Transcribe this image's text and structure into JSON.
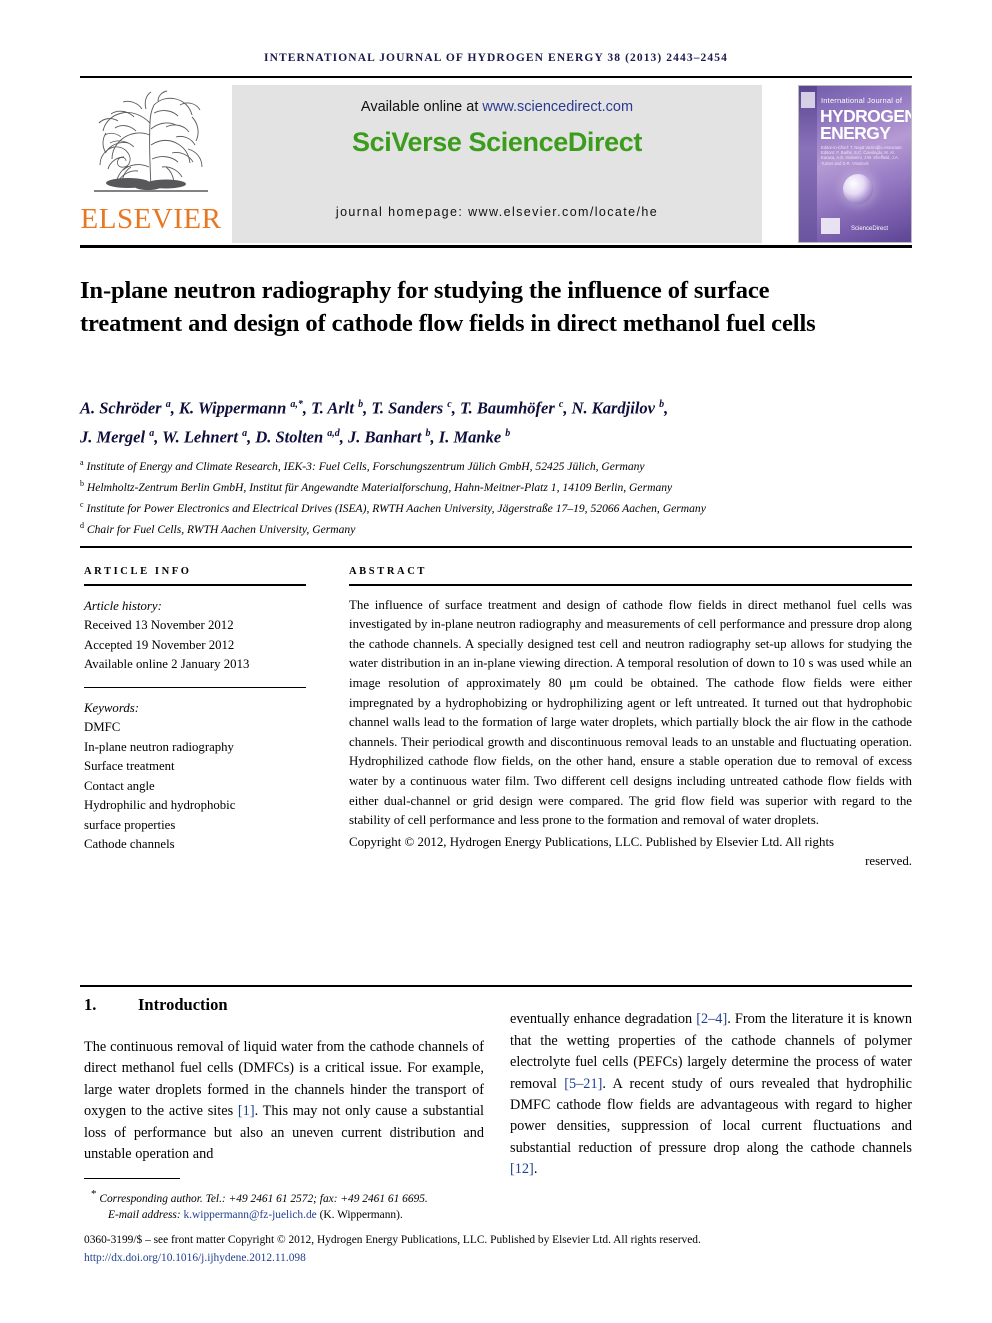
{
  "running_head": "International Journal of Hydrogen Energy 38 (2013) 2443–2454",
  "banner": {
    "publisher_name": "ELSEVIER",
    "available_prefix": "Available online at ",
    "available_url": "www.sciencedirect.com",
    "platform": "SciVerse ScienceDirect",
    "homepage": "journal homepage: www.elsevier.com/locate/he",
    "cover": {
      "line1": "International Journal of",
      "line2": "HYDROGEN",
      "line3": "ENERGY",
      "editors": "Editor-in-Chief: T. Nejat Veziroğlu   Associate Editors: F. Barbir, S.C. Cavuloglu, M. Al. Karaca, A.E. Hosseini, J.W. Sheffield, J.A. Turner and D.R. Vrsalović",
      "sciencedirect": "ScienceDirect"
    }
  },
  "title": "In-plane neutron radiography for studying the influence of surface treatment and design of cathode flow fields in direct methanol fuel cells",
  "authors_line1": "A. Schröder <sup>a</sup>, K. Wippermann <sup>a,*</sup>, T. Arlt <sup>b</sup>, T. Sanders <sup>c</sup>, T. Baumhöfer <sup>c</sup>, N. Kardjilov <sup>b</sup>,",
  "authors_line2": "J. Mergel <sup>a</sup>, W. Lehnert <sup>a</sup>, D. Stolten <sup>a,d</sup>, J. Banhart <sup>b</sup>, I. Manke <sup>b</sup>",
  "affiliations": [
    "<sup>a</sup> Institute of Energy and Climate Research, IEK-3: Fuel Cells, Forschungszentrum Jülich GmbH, 52425 Jülich, Germany",
    "<sup>b</sup> Helmholtz-Zentrum Berlin GmbH, Institut für Angewandte Materialforschung, Hahn-Meitner-Platz 1, 14109 Berlin, Germany",
    "<sup>c</sup> Institute for Power Electronics and Electrical Drives (ISEA), RWTH Aachen University, Jägerstraße 17–19, 52066 Aachen, Germany",
    "<sup>d</sup> Chair for Fuel Cells, RWTH Aachen University, Germany"
  ],
  "article_info": {
    "heading": "ARTICLE INFO",
    "history_label": "Article history:",
    "history": [
      "Received 13 November 2012",
      "Accepted 19 November 2012",
      "Available online 2 January 2013"
    ],
    "keywords_label": "Keywords:",
    "keywords": [
      "DMFC",
      "In-plane neutron radiography",
      "Surface treatment",
      "Contact angle",
      "Hydrophilic and hydrophobic",
      "surface properties",
      "Cathode channels"
    ]
  },
  "abstract": {
    "heading": "ABSTRACT",
    "body": "The influence of surface treatment and design of cathode flow fields in direct methanol fuel cells was investigated by in-plane neutron radiography and measurements of cell performance and pressure drop along the cathode channels. A specially designed test cell and neutron radiography set-up allows for studying the water distribution in an in-plane viewing direction. A temporal resolution of down to 10 s was used while an image resolution of approximately 80 μm could be obtained. The cathode flow fields were either impregnated by a hydrophobizing or hydrophilizing agent or left untreated. It turned out that hydrophobic channel walls lead to the formation of large water droplets, which partially block the air flow in the cathode channels. Their periodical growth and discontinuous removal leads to an unstable and fluctuating operation. Hydrophilized cathode flow fields, on the other hand, ensure a stable operation due to removal of excess water by a continuous water film. Two different cell designs including untreated cathode flow fields with either dual-channel or grid design were compared. The grid flow field was superior with regard to the stability of cell performance and less prone to the formation and removal of water droplets.",
    "copyright_main": "Copyright © 2012, Hydrogen Energy Publications, LLC. Published by Elsevier Ltd. All rights",
    "copyright_tail": "reserved."
  },
  "section": {
    "number": "1.",
    "heading": "Introduction"
  },
  "intro_left": "The continuous removal of liquid water from the cathode channels of direct methanol fuel cells (DMFCs) is a critical issue. For example, large water droplets formed in the channels hinder the transport of oxygen to the active sites [1]. This may not only cause a substantial loss of performance but also an uneven current distribution and unstable operation and",
  "intro_right": "eventually enhance degradation [2–4]. From the literature it is known that the wetting properties of the cathode channels of polymer electrolyte fuel cells (PEFCs) largely determine the process of water removal [5–21]. A recent study of ours revealed that hydrophilic DMFC cathode flow fields are advantageous with regard to higher power densities, suppression of local current fluctuations and substantial reduction of pressure drop along the cathode channels [12].",
  "footnotes": {
    "corresponding": "Corresponding author. Tel.: +49 2461 61 2572; fax: +49 2461 61 6695.",
    "email_label": "E-mail address: ",
    "email": "k.wippermann@fz-juelich.de",
    "email_suffix": " (K. Wippermann).",
    "issn_line": "0360-3199/$ – see front matter Copyright © 2012, Hydrogen Energy Publications, LLC. Published by Elsevier Ltd. All rights reserved.",
    "doi": "http://dx.doi.org/10.1016/j.ijhydene.2012.11.098"
  },
  "colors": {
    "elsevier_orange": "#e87722",
    "sciencedirect_green": "#3c9c1c",
    "link_blue": "#2b3a90",
    "running_head_navy": "#1a1a4e",
    "author_navy": "#0e0e3c"
  }
}
